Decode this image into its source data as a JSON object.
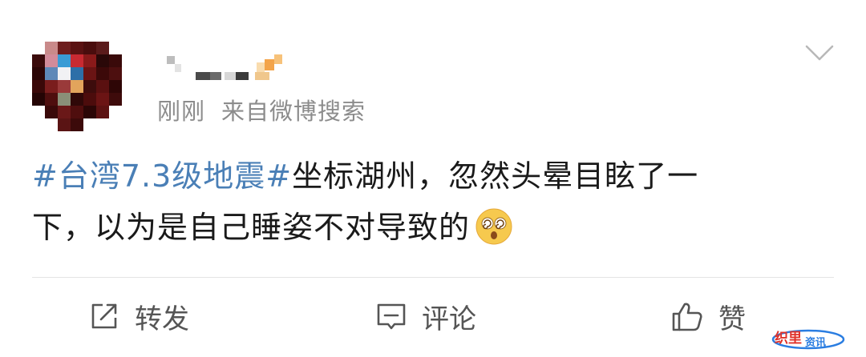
{
  "post": {
    "meta": {
      "time": "刚刚",
      "source": "来自微博搜索"
    },
    "content": {
      "topic": "#台湾7.3级地震#",
      "text_line1": "坐标湖州，忽然头晕目眩了一",
      "text_line2": "下，以为是自己睡姿不对导致的"
    },
    "emoji": "dizzy-face-emoji"
  },
  "actions": {
    "repost_label": "转发",
    "comment_label": "评论",
    "like_label": "赞"
  },
  "watermark": {
    "text": "织里资讯"
  },
  "colors": {
    "topic": "#4a7fb6",
    "text": "#1a1a1a",
    "meta": "#8c8c8c",
    "actions": "#555555",
    "divider": "#e4e4e4"
  },
  "icons": {
    "chevron": "chevron-down-icon",
    "repost": "repost-icon",
    "comment": "comment-icon",
    "like": "thumbs-up-icon"
  }
}
